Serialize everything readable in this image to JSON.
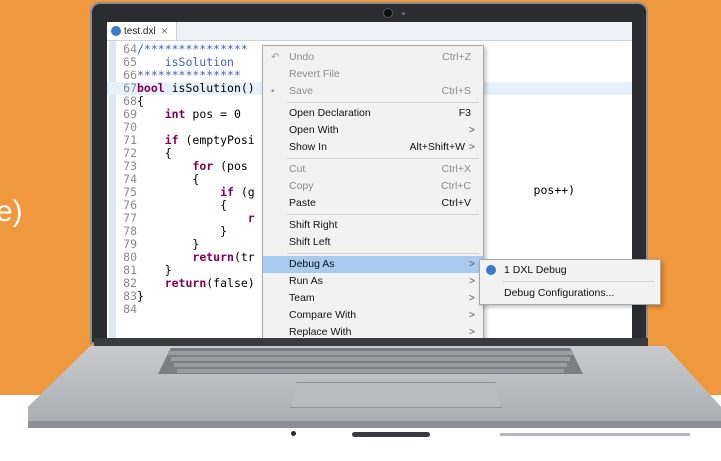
{
  "background": {
    "accent_color": "#f0983d",
    "cutoff_text": "e)"
  },
  "editor": {
    "tab": {
      "title": "test.dxl",
      "close_symbol": "✕",
      "icon": "dxl-file-icon"
    },
    "lines": [
      {
        "n": "64",
        "segments": [
          {
            "t": "/***************",
            "c": "cm"
          }
        ]
      },
      {
        "n": "65",
        "segments": [
          {
            "t": "    isSolution",
            "c": "cm"
          }
        ]
      },
      {
        "n": "66",
        "segments": [
          {
            "t": "***************",
            "c": "cm"
          }
        ]
      },
      {
        "n": "67",
        "segments": [
          {
            "t": "bool",
            "c": "kw"
          },
          {
            "t": " isSolution()",
            "c": "code"
          }
        ],
        "current": true
      },
      {
        "n": "68",
        "segments": [
          {
            "t": "{",
            "c": "code"
          }
        ]
      },
      {
        "n": "69",
        "segments": [
          {
            "t": "    ",
            "c": "code"
          },
          {
            "t": "int",
            "c": "kw"
          },
          {
            "t": " pos = 0",
            "c": "code"
          }
        ]
      },
      {
        "n": "70",
        "segments": []
      },
      {
        "n": "71",
        "segments": [
          {
            "t": "    ",
            "c": "code"
          },
          {
            "t": "if",
            "c": "kw"
          },
          {
            "t": " (emptyPosi",
            "c": "code"
          }
        ]
      },
      {
        "n": "72",
        "segments": [
          {
            "t": "    {",
            "c": "code"
          }
        ]
      },
      {
        "n": "73",
        "segments": [
          {
            "t": "        ",
            "c": "code"
          },
          {
            "t": "for",
            "c": "kw"
          },
          {
            "t": " (pos",
            "c": "code"
          }
        ]
      },
      {
        "n": "74",
        "segments": [
          {
            "t": "        {",
            "c": "code"
          }
        ]
      },
      {
        "n": "75",
        "segments": [
          {
            "t": "            ",
            "c": "code"
          },
          {
            "t": "if",
            "c": "kw"
          },
          {
            "t": " (g",
            "c": "code"
          }
        ]
      },
      {
        "n": "76",
        "segments": [
          {
            "t": "            {",
            "c": "code"
          }
        ]
      },
      {
        "n": "77",
        "segments": [
          {
            "t": "                ",
            "c": "code"
          },
          {
            "t": "r",
            "c": "kw"
          }
        ]
      },
      {
        "n": "78",
        "segments": [
          {
            "t": "            }",
            "c": "code"
          }
        ]
      },
      {
        "n": "79",
        "segments": [
          {
            "t": "        }",
            "c": "code"
          }
        ]
      },
      {
        "n": "80",
        "segments": [
          {
            "t": "        ",
            "c": "code"
          },
          {
            "t": "return",
            "c": "kw"
          },
          {
            "t": "(tr",
            "c": "code"
          }
        ]
      },
      {
        "n": "81",
        "segments": [
          {
            "t": "    }",
            "c": "code"
          }
        ]
      },
      {
        "n": "82",
        "segments": [
          {
            "t": "    ",
            "c": "code"
          },
          {
            "t": "return",
            "c": "kw"
          },
          {
            "t": "(false)",
            "c": "code"
          }
        ]
      },
      {
        "n": "83",
        "segments": [
          {
            "t": "}",
            "c": "code"
          }
        ]
      },
      {
        "n": "84",
        "segments": []
      }
    ],
    "overflow_code": "pos++)"
  },
  "context_menu": {
    "items": [
      {
        "label": "Undo",
        "shortcut": "Ctrl+Z",
        "disabled": true,
        "icon": "undo-icon"
      },
      {
        "label": "Revert File",
        "shortcut": "",
        "disabled": true
      },
      {
        "label": "Save",
        "shortcut": "Ctrl+S",
        "disabled": true,
        "icon": "save-icon"
      },
      {
        "separator": true
      },
      {
        "label": "Open Declaration",
        "shortcut": "F3"
      },
      {
        "label": "Open With",
        "shortcut": "",
        "submenu": true
      },
      {
        "label": "Show In",
        "shortcut": "Alt+Shift+W",
        "submenu": true
      },
      {
        "separator": true
      },
      {
        "label": "Cut",
        "shortcut": "Ctrl+X",
        "disabled": true
      },
      {
        "label": "Copy",
        "shortcut": "Ctrl+C",
        "disabled": true
      },
      {
        "label": "Paste",
        "shortcut": "Ctrl+V"
      },
      {
        "separator": true
      },
      {
        "label": "Shift Right",
        "shortcut": ""
      },
      {
        "label": "Shift Left",
        "shortcut": ""
      },
      {
        "separator": true
      },
      {
        "label": "Debug As",
        "shortcut": "",
        "submenu": true,
        "active": true
      },
      {
        "label": "Run As",
        "shortcut": "",
        "submenu": true
      },
      {
        "label": "Team",
        "shortcut": "",
        "submenu": true
      },
      {
        "label": "Compare With",
        "shortcut": "",
        "submenu": true
      },
      {
        "label": "Replace With",
        "shortcut": "",
        "submenu": true
      }
    ],
    "submenu_arrow": ">"
  },
  "debug_submenu": {
    "items": [
      {
        "label": "1 DXL Debug",
        "icon": "dxl-debug-icon"
      },
      {
        "label": "Debug Configurations..."
      }
    ]
  }
}
